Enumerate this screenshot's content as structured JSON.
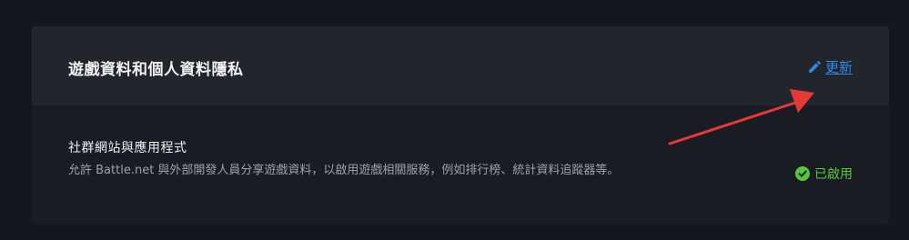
{
  "section": {
    "title": "遊戲資料和個人資料隱私",
    "edit_label": "更新"
  },
  "setting": {
    "title": "社群網站與應用程式",
    "description": "允許 Battle.net 與外部開發人員分享遊戲資料，以啟用遊戲相關服務，例如排行榜、統計資料追蹤器等。",
    "status": "已啟用"
  },
  "icons": {
    "edit": "pencil-icon",
    "status": "check-circle-icon"
  },
  "colors": {
    "page_background": "#15171e",
    "header_background": "#23252d",
    "body_background": "#1a1c24",
    "link": "#2e8ae6",
    "enabled": "#54c73a",
    "annotation_arrow": "#e53935"
  }
}
